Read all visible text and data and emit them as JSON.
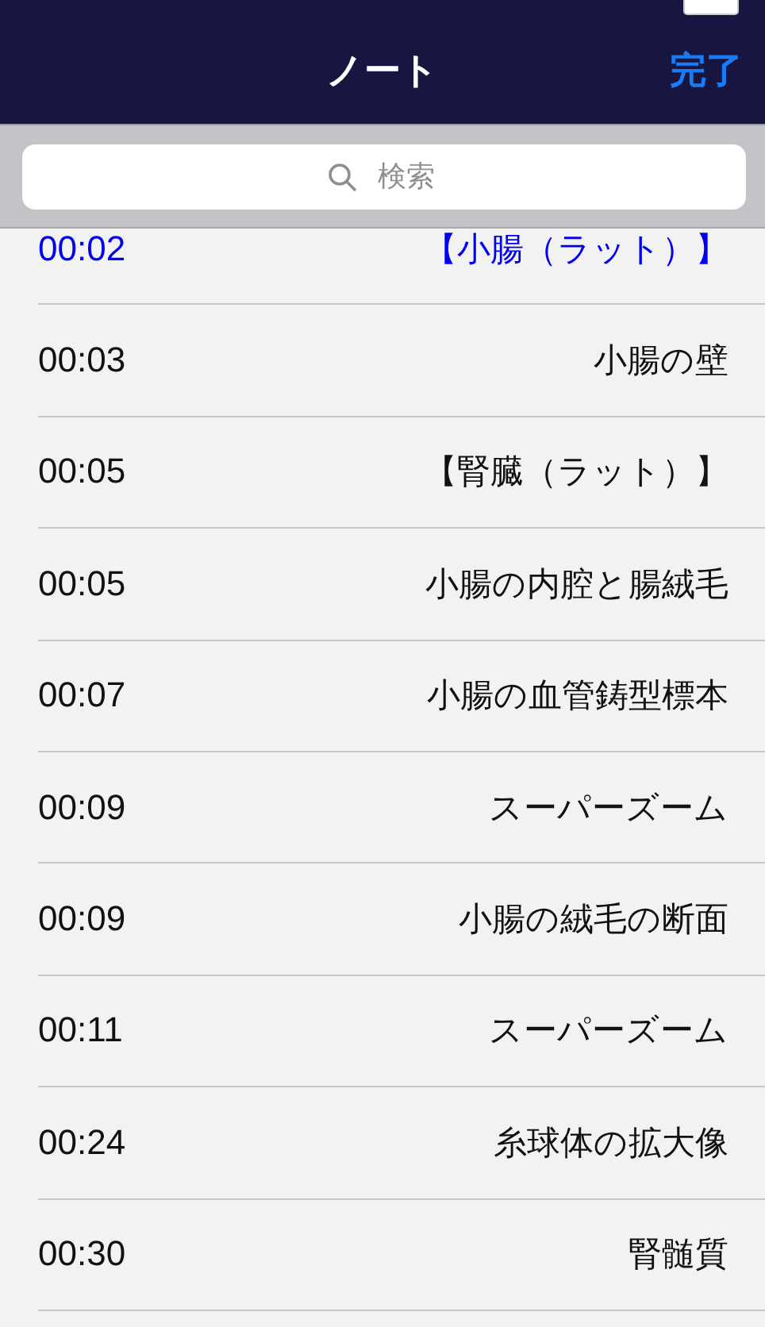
{
  "nav": {
    "title": "ノート",
    "done": "完了"
  },
  "search": {
    "placeholder": "検索"
  },
  "notes": [
    {
      "time": "00:02",
      "title": "【小腸（ラット）】",
      "selected": true
    },
    {
      "time": "00:03",
      "title": "小腸の壁",
      "selected": false
    },
    {
      "time": "00:05",
      "title": "【腎臓（ラット）】",
      "selected": false
    },
    {
      "time": "00:05",
      "title": "小腸の内腔と腸絨毛",
      "selected": false
    },
    {
      "time": "00:07",
      "title": "小腸の血管鋳型標本",
      "selected": false
    },
    {
      "time": "00:09",
      "title": "スーパーズーム",
      "selected": false
    },
    {
      "time": "00:09",
      "title": "小腸の絨毛の断面",
      "selected": false
    },
    {
      "time": "00:11",
      "title": "スーパーズーム",
      "selected": false
    },
    {
      "time": "00:24",
      "title": "糸球体の拡大像",
      "selected": false
    },
    {
      "time": "00:30",
      "title": "腎髄質",
      "selected": false
    }
  ]
}
